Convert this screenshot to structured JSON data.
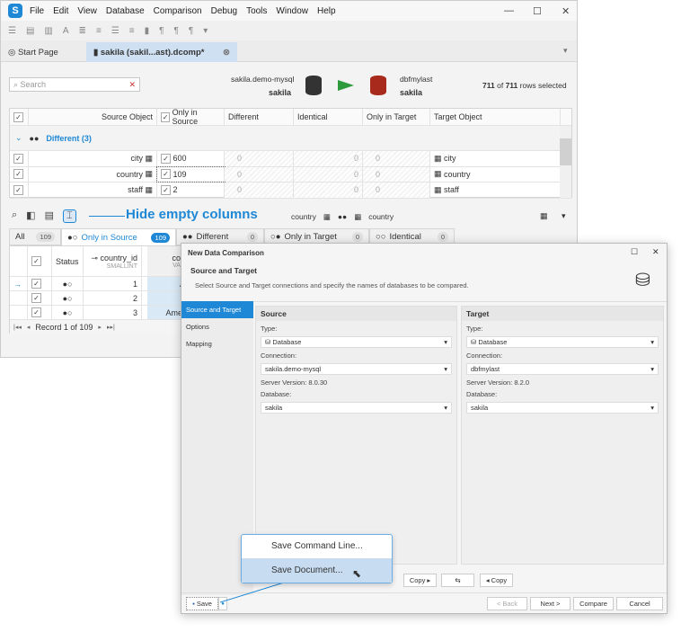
{
  "menu": {
    "items": [
      "File",
      "Edit",
      "View",
      "Database",
      "Comparison",
      "Debug",
      "Tools",
      "Window",
      "Help"
    ]
  },
  "tabs": [
    {
      "label": "Start Page"
    },
    {
      "label": "sakila (sakil...ast).dcomp*"
    }
  ],
  "search": {
    "placeholder": "Search"
  },
  "source": {
    "connection": "sakila.demo-mysql",
    "database": "sakila"
  },
  "target": {
    "connection": "dbfmylast",
    "database": "sakila"
  },
  "selection": {
    "selected": "711",
    "of": "of",
    "total": "711",
    "suffix": "rows selected"
  },
  "grid": {
    "headers": [
      "Source Object",
      "Only in Source",
      "Different",
      "Identical",
      "Only in Target",
      "Target Object"
    ],
    "group": "Different (3)",
    "rows": [
      {
        "source": "city",
        "only_source": "600",
        "different": "0",
        "identical": "0",
        "only_target": "0",
        "target": "city"
      },
      {
        "source": "country",
        "only_source": "109",
        "different": "0",
        "identical": "0",
        "only_target": "0",
        "target": "country"
      },
      {
        "source": "staff",
        "only_source": "2",
        "different": "0",
        "identical": "0",
        "only_target": "0",
        "target": "staff"
      }
    ]
  },
  "callout": {
    "hide_empty": "Hide empty columns"
  },
  "detail": {
    "source_table": "country",
    "target_table": "country",
    "tabs": [
      {
        "label": "All",
        "count": "109"
      },
      {
        "label": "Only in Source",
        "count": "109"
      },
      {
        "label": "Different",
        "count": "0"
      },
      {
        "label": "Only in Target",
        "count": "0"
      },
      {
        "label": "Identical",
        "count": "0"
      }
    ],
    "headers": {
      "status": "Status",
      "col1": "country_id",
      "col1_type": "SMALLINT",
      "col2": "cou",
      "col2_type": "VAR"
    },
    "rows": [
      {
        "id": "1",
        "val": "A"
      },
      {
        "id": "2",
        "val": ""
      },
      {
        "id": "3",
        "val": "Amer"
      }
    ],
    "record": "Record 1 of 109"
  },
  "dialog": {
    "title": "New Data Comparison",
    "heading": "Source and Target",
    "description": "Select Source and Target connections and specify the names of databases to be compared.",
    "nav": [
      "Source and Target",
      "Options",
      "Mapping"
    ],
    "source": {
      "title": "Source",
      "type_label": "Type:",
      "type": "Database",
      "conn_label": "Connection:",
      "conn": "sakila.demo-mysql",
      "version": "Server Version: 8.0.30",
      "db_label": "Database:",
      "db": "sakila"
    },
    "target": {
      "title": "Target",
      "type_label": "Type:",
      "type": "Database",
      "conn_label": "Connection:",
      "conn": "dbfmylast",
      "version": "Server Version: 8.2.0",
      "db_label": "Database:",
      "db": "sakila"
    },
    "copy_right": "Copy",
    "copy_left": "Copy",
    "swap": "⇆",
    "save": "Save",
    "back": "< Back",
    "next": "Next >",
    "compare": "Compare",
    "cancel": "Cancel"
  },
  "popup": {
    "items": [
      "Save Command Line...",
      "Save Document..."
    ]
  },
  "colors": {
    "accent": "#1e88d6",
    "arrow": "#2e9a3e",
    "target_db": "#a82a1c"
  }
}
